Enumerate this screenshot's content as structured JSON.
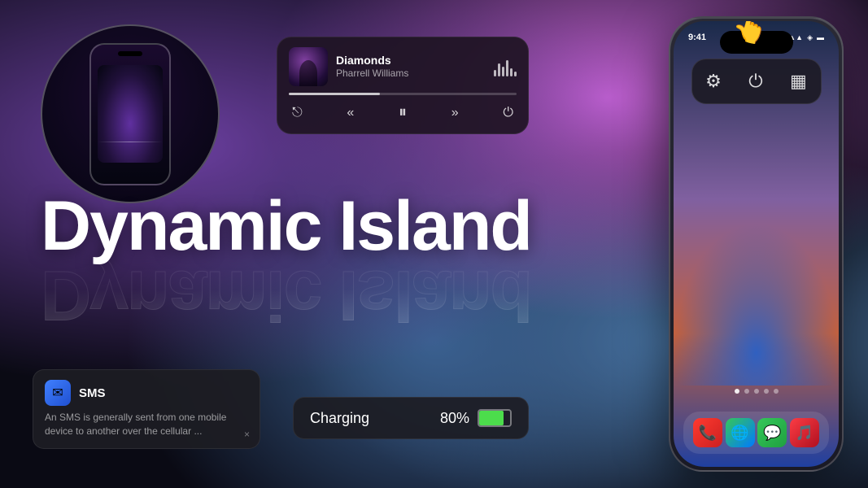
{
  "background": {
    "desc": "dark gradient background with purple and blue tones"
  },
  "left_phone": {
    "alt": "iPhone with Dynamic Island"
  },
  "music_widget": {
    "title": "Diamonds",
    "artist": "Pharrell Williams",
    "progress": 40
  },
  "headline": {
    "line1": "Dynamic Island",
    "reflection": "Dynamic Island"
  },
  "sms_notification": {
    "app_name": "SMS",
    "body": "An SMS is generally sent from one mobile device to another over the cellular ...",
    "close_label": "×"
  },
  "charging_widget": {
    "label": "Charging",
    "percent": "80%",
    "battery_fill": 80
  },
  "right_phone": {
    "status_time": "9:41",
    "status_icons": "▲▲▲",
    "popup_icons": [
      "⚙",
      "⏻",
      "▦"
    ],
    "dock_apps": [
      {
        "name": "Phone",
        "icon": "📞"
      },
      {
        "name": "Safari",
        "icon": "🌐"
      },
      {
        "name": "Messages",
        "icon": "💬"
      },
      {
        "name": "Music",
        "icon": "🎵"
      }
    ]
  },
  "icons": {
    "share": "⎋",
    "rewind": "«",
    "pause": "⏸",
    "forward": "»",
    "power": "⏻",
    "mail": "✉"
  }
}
